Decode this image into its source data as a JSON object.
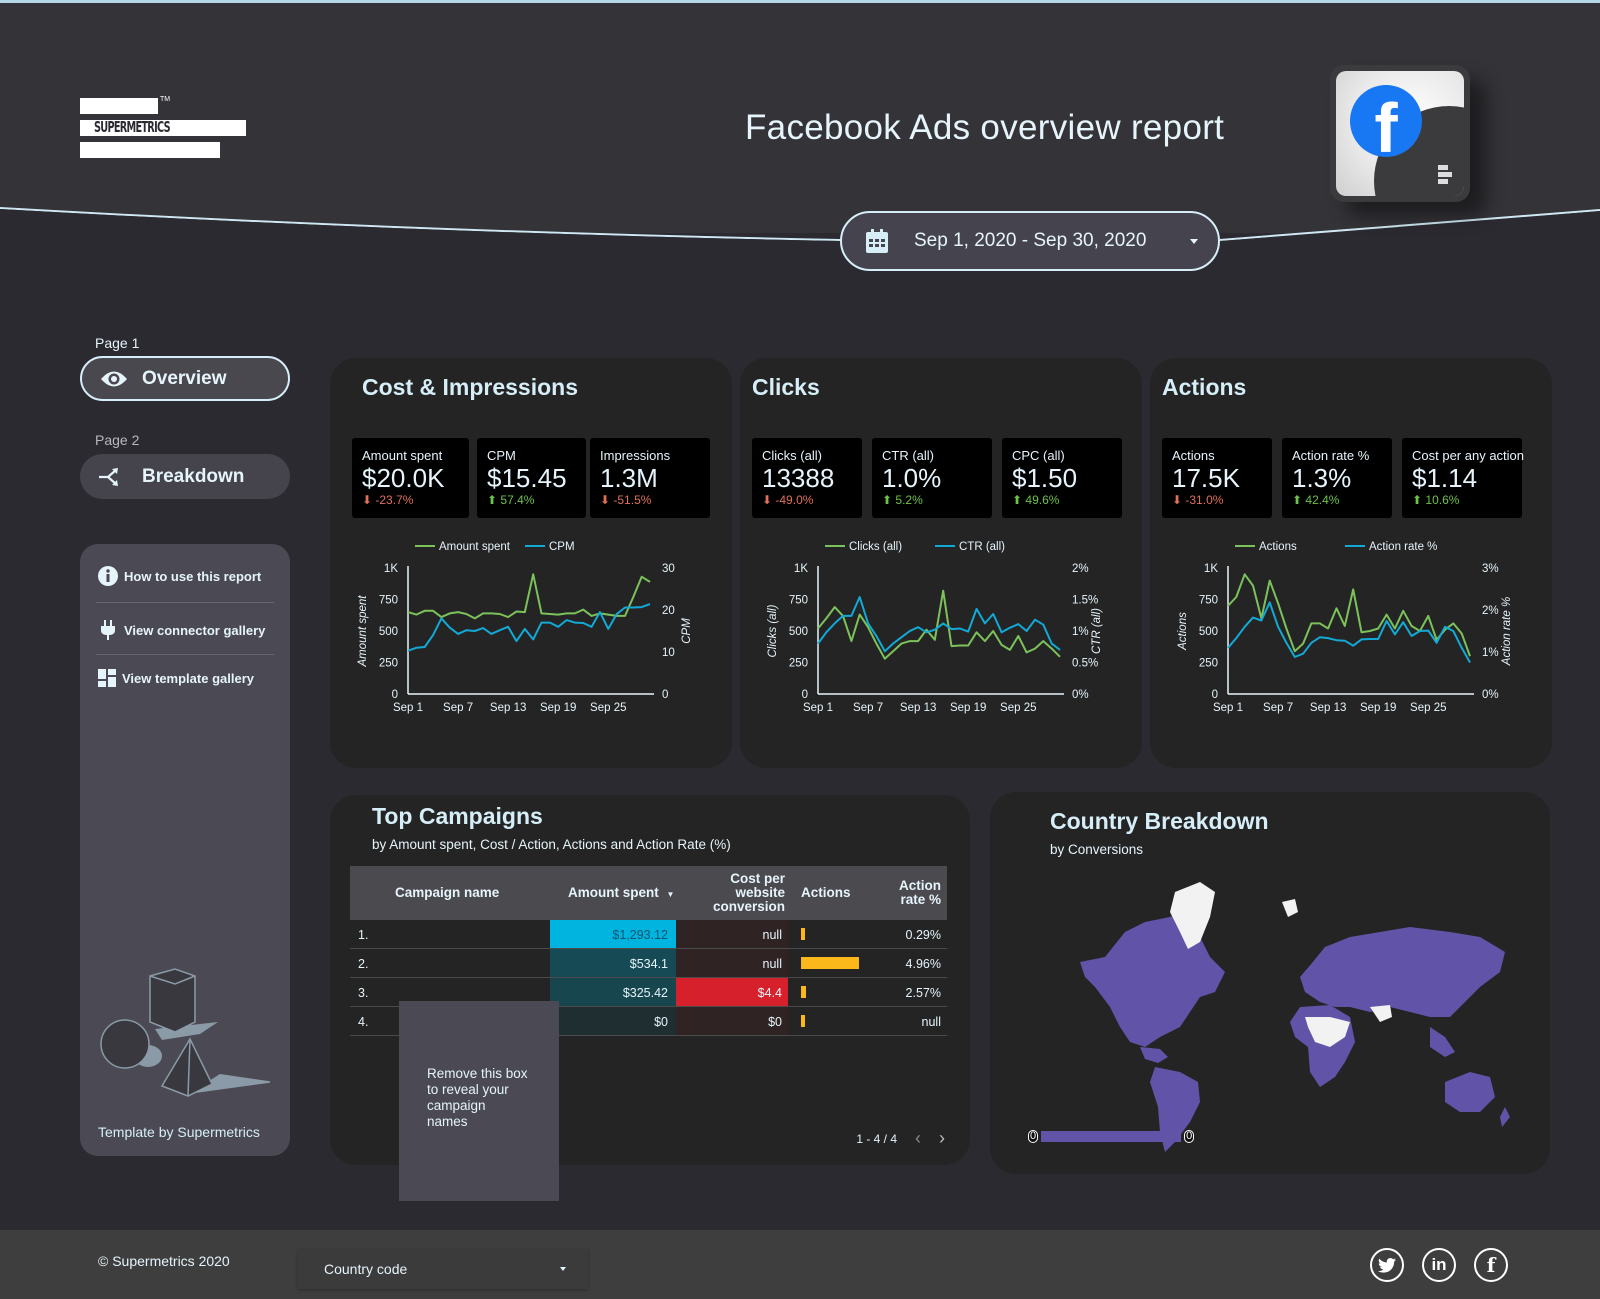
{
  "header": {
    "logo_text": "SUPERMETRICS",
    "logo_tm": "TM",
    "title": "Facebook Ads overview report",
    "connector_logo": "f",
    "date_range": "Sep 1, 2020 - Sep 30, 2020"
  },
  "sidebar": {
    "pages": [
      {
        "page_label": "Page 1",
        "label": "Overview",
        "icon": "eye-icon",
        "active": true
      },
      {
        "page_label": "Page 2",
        "label": "Breakdown",
        "icon": "split-arrows-icon",
        "active": false
      }
    ],
    "links": [
      {
        "label": "How to use this report",
        "icon": "info-icon"
      },
      {
        "label": "View connector gallery",
        "icon": "plug-icon"
      },
      {
        "label": "View template gallery",
        "icon": "grid-icon"
      }
    ],
    "footer_text": "Template by Supermetrics"
  },
  "cards": {
    "cost": {
      "title": "Cost & Impressions",
      "kpis": [
        {
          "label": "Amount spent",
          "value": "$20.0K",
          "delta": "-23.7%",
          "dir": "down"
        },
        {
          "label": "CPM",
          "value": "$15.45",
          "delta": "57.4%",
          "dir": "up"
        },
        {
          "label": "Impressions",
          "value": "1.3M",
          "delta": "-51.5%",
          "dir": "down"
        }
      ]
    },
    "clicks": {
      "title": "Clicks",
      "kpis": [
        {
          "label": "Clicks (all)",
          "value": "13388",
          "delta": "-49.0%",
          "dir": "down"
        },
        {
          "label": "CTR (all)",
          "value": "1.0%",
          "delta": "5.2%",
          "dir": "up"
        },
        {
          "label": "CPC (all)",
          "value": "$1.50",
          "delta": "49.6%",
          "dir": "up"
        }
      ]
    },
    "actions": {
      "title": "Actions",
      "kpis": [
        {
          "label": "Actions",
          "value": "17.5K",
          "delta": "-31.0%",
          "dir": "down"
        },
        {
          "label": "Action rate %",
          "value": "1.3%",
          "delta": "42.4%",
          "dir": "up"
        },
        {
          "label": "Cost per any action",
          "value": "$1.14",
          "delta": "10.6%",
          "dir": "up"
        }
      ]
    }
  },
  "colors": {
    "series_primary": "#7cc25a",
    "series_secondary": "#13a9d6",
    "delta_down": "#e0705a",
    "delta_up": "#6cc24a",
    "map_fill": "#6153a8",
    "bar_fill": "#fbb81b",
    "highlight_red": "#d6202b"
  },
  "chart_data": [
    {
      "type": "line",
      "title": "Cost & Impressions",
      "x_ticks": [
        "Sep 1",
        "Sep 7",
        "Sep 13",
        "Sep 19",
        "Sep 25"
      ],
      "x_count": 30,
      "ylabel": "Amount spent",
      "y2label": "CPM",
      "ylim": [
        0,
        1000
      ],
      "y2lim": [
        0,
        30
      ],
      "y_ticks": [
        "0",
        "250",
        "500",
        "750",
        "1K"
      ],
      "y2_ticks": [
        "0",
        "10",
        "20",
        "30"
      ],
      "y2_tick_values": [
        0,
        10,
        20,
        30
      ],
      "legend_position": "top",
      "series": [
        {
          "name": "Amount spent",
          "axis": "left",
          "values": [
            650,
            630,
            660,
            660,
            610,
            640,
            650,
            635,
            600,
            640,
            640,
            635,
            610,
            655,
            650,
            950,
            640,
            635,
            630,
            640,
            640,
            670,
            620,
            640,
            630,
            620,
            620,
            770,
            930,
            890
          ]
        },
        {
          "name": "CPM",
          "axis": "right",
          "values": [
            10.3,
            11,
            11.2,
            14,
            18,
            15.8,
            14.3,
            15.2,
            15,
            15.7,
            14.3,
            15.2,
            16,
            12.6,
            15.5,
            13,
            17,
            17,
            16,
            17.6,
            17,
            16.9,
            16,
            19.5,
            15.5,
            19,
            20.6,
            20.6,
            20.7,
            21.4
          ]
        }
      ]
    },
    {
      "type": "line",
      "title": "Clicks",
      "x_ticks": [
        "Sep 1",
        "Sep 7",
        "Sep 13",
        "Sep 19",
        "Sep 25"
      ],
      "x_count": 30,
      "ylabel": "Clicks (all)",
      "y2label": "CTR (all)",
      "ylim": [
        0,
        1000
      ],
      "y2lim": [
        0,
        2
      ],
      "y_ticks": [
        "0",
        "250",
        "500",
        "750",
        "1K"
      ],
      "y2_ticks": [
        "0%",
        "0.5%",
        "1%",
        "1.5%",
        "2%"
      ],
      "y2_tick_values": [
        0,
        0.5,
        1,
        1.5,
        2
      ],
      "legend_position": "top",
      "series": [
        {
          "name": "Clicks (all)",
          "axis": "left",
          "values": [
            520,
            600,
            690,
            620,
            420,
            630,
            530,
            400,
            280,
            340,
            400,
            420,
            420,
            510,
            430,
            820,
            380,
            385,
            385,
            490,
            420,
            500,
            390,
            350,
            460,
            330,
            360,
            420,
            360,
            295
          ]
        },
        {
          "name": "CTR (all)",
          "axis": "right",
          "values": [
            0.8,
            0.98,
            1.12,
            1.24,
            1.24,
            1.54,
            1.12,
            0.92,
            0.68,
            0.8,
            0.9,
            1.0,
            1.06,
            0.98,
            1.02,
            1.12,
            1.03,
            1.04,
            0.99,
            1.35,
            1.12,
            1.27,
            0.98,
            1.05,
            1.11,
            1.0,
            1.18,
            1.1,
            0.8,
            0.7
          ]
        }
      ]
    },
    {
      "type": "line",
      "title": "Actions",
      "x_ticks": [
        "Sep 1",
        "Sep 7",
        "Sep 13",
        "Sep 19",
        "Sep 25"
      ],
      "x_count": 30,
      "ylabel": "Actions",
      "y2label": "Action rate %",
      "ylim": [
        0,
        1000
      ],
      "y2lim": [
        0,
        3
      ],
      "y_ticks": [
        "0",
        "250",
        "500",
        "750",
        "1K"
      ],
      "y2_ticks": [
        "0%",
        "1%",
        "2%",
        "3%"
      ],
      "y2_tick_values": [
        0,
        1,
        2,
        3
      ],
      "legend_position": "top",
      "series": [
        {
          "name": "Actions",
          "axis": "left",
          "values": [
            700,
            770,
            950,
            860,
            600,
            900,
            720,
            520,
            340,
            400,
            560,
            560,
            520,
            680,
            540,
            830,
            490,
            500,
            520,
            630,
            520,
            660,
            540,
            500,
            620,
            430,
            510,
            560,
            480,
            300
          ]
        },
        {
          "name": "Action rate %",
          "axis": "right",
          "values": [
            1.1,
            1.33,
            1.6,
            1.82,
            1.75,
            2.18,
            1.6,
            1.22,
            0.88,
            0.96,
            1.22,
            1.35,
            1.33,
            1.28,
            1.27,
            1.15,
            1.3,
            1.31,
            1.31,
            1.74,
            1.42,
            1.71,
            1.38,
            1.5,
            1.51,
            1.22,
            1.6,
            1.5,
            1.1,
            0.75
          ]
        }
      ]
    },
    {
      "type": "table",
      "title": "Top Campaigns",
      "subtitle": "by  Amount spent, Cost / Action, Actions and Action Rate (%)",
      "columns": [
        "Campaign name",
        "Amount spent",
        "Cost per website conversion",
        "Actions",
        "Action rate %"
      ],
      "sort_column": "Amount spent",
      "rows": [
        {
          "index": "1.",
          "amount": "$1,293.12",
          "amount_value": 1293.12,
          "cost_per_conv": "null",
          "actions_fraction": 0.05,
          "action_rate": "0.29%"
        },
        {
          "index": "2.",
          "amount": "$534.1",
          "amount_value": 534.1,
          "cost_per_conv": "null",
          "actions_fraction": 1.0,
          "action_rate": "4.96%"
        },
        {
          "index": "3.",
          "amount": "$325.42",
          "amount_value": 325.42,
          "cost_per_conv": "$4.4",
          "actions_fraction": 0.08,
          "action_rate": "2.57%"
        },
        {
          "index": "4.",
          "amount": "$0",
          "amount_value": 0,
          "cost_per_conv": "$0",
          "actions_fraction": 0.03,
          "action_rate": "null"
        }
      ]
    }
  ],
  "campaigns": {
    "title": "Top Campaigns",
    "subtitle": "by  Amount spent, Cost / Action, Actions and Action Rate (%)",
    "headers": {
      "name": "Campaign name",
      "amount": "Amount spent",
      "cost_per_conv_1": "Cost per",
      "cost_per_conv_2": "website",
      "cost_per_conv_3": "conversion",
      "actions": "Actions",
      "rate_1": "Action",
      "rate_2": "rate %"
    },
    "overlay_text": [
      "Remove this box",
      "to reveal your",
      "campaign",
      "names"
    ],
    "pagination": "1 - 4 / 4"
  },
  "map": {
    "title": "Country Breakdown",
    "subtitle": "by Conversions",
    "legend_min": "0",
    "legend_max": "0"
  },
  "footer": {
    "copyright": "© Supermetrics 2020",
    "country_select": "Country code",
    "social": [
      {
        "name": "twitter",
        "glyph": "🐦"
      },
      {
        "name": "linkedin",
        "glyph": "in"
      },
      {
        "name": "facebook",
        "glyph": "f"
      }
    ]
  }
}
